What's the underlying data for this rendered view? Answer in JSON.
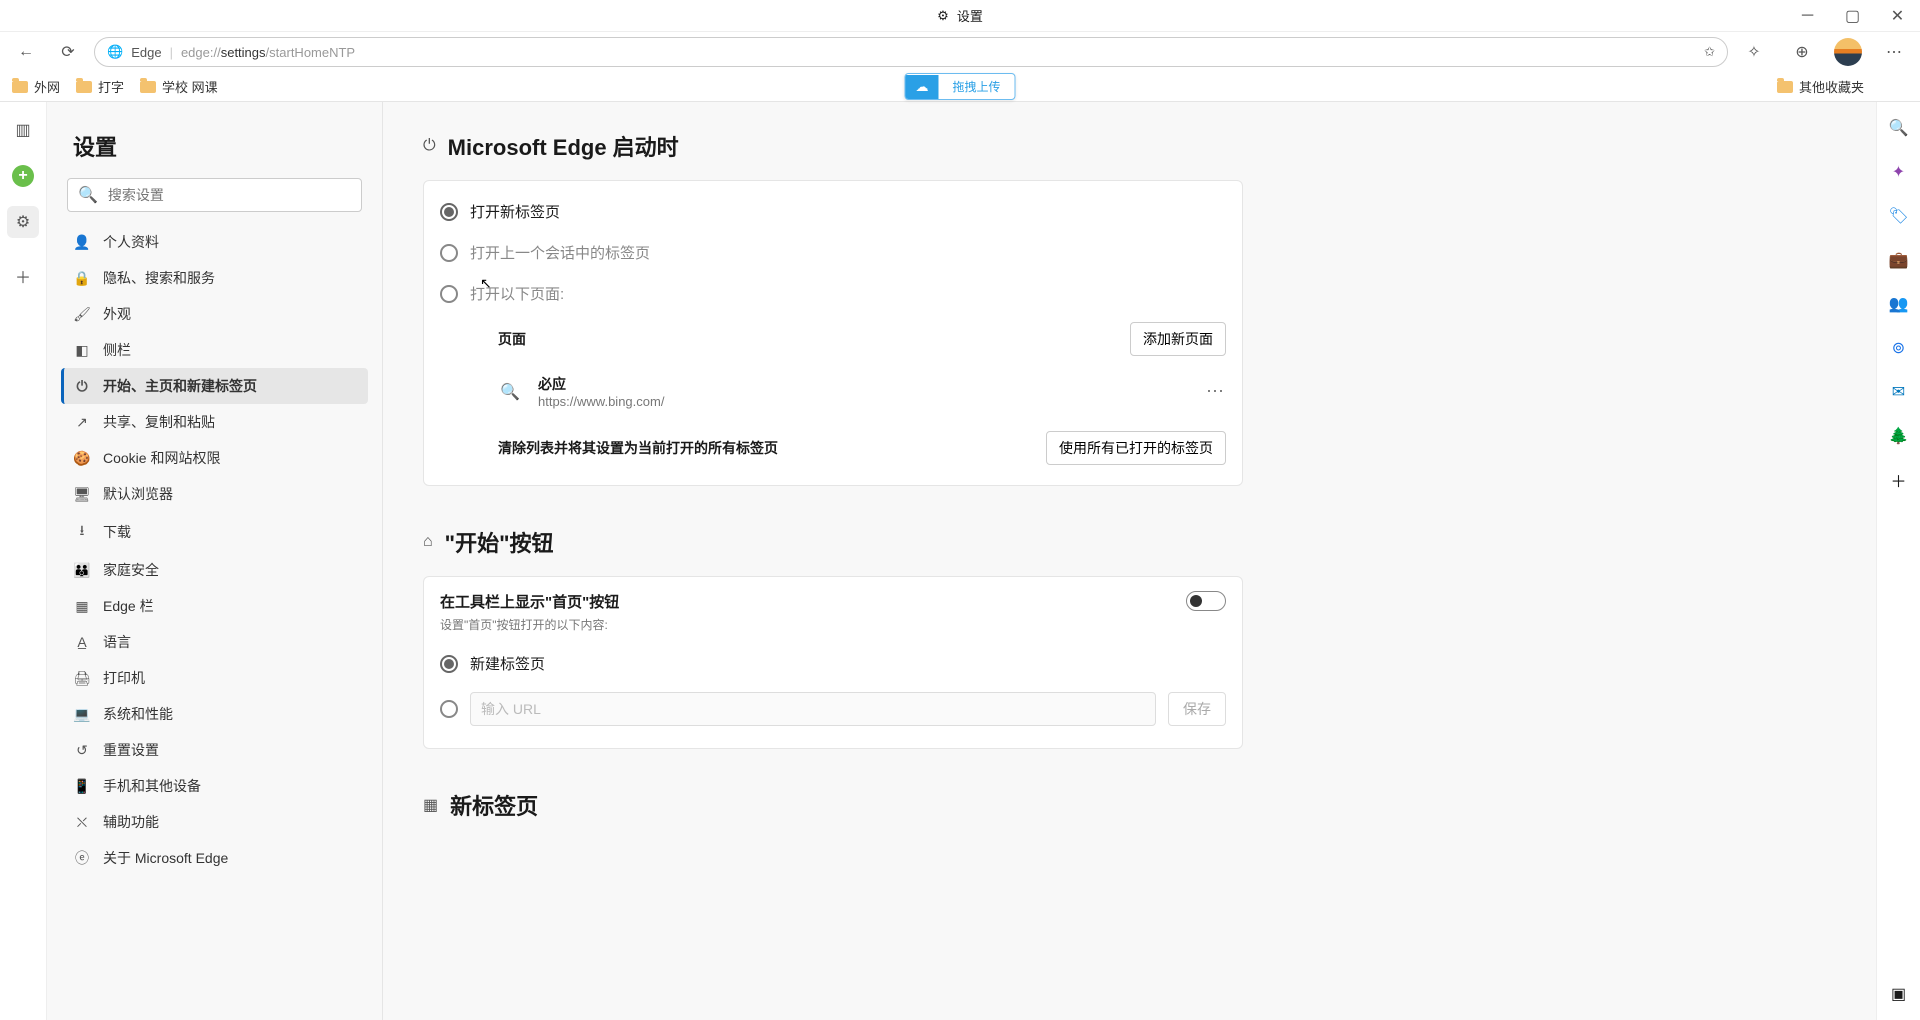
{
  "titlebar": {
    "label": "设置"
  },
  "toolbar": {
    "edge_label": "Edge",
    "url_prefix": "edge://",
    "url_bold": "settings",
    "url_rest": "/startHomeNTP"
  },
  "bookmarks": {
    "items": [
      "外网",
      "打字",
      "学校 网课"
    ],
    "right": "其他收藏夹",
    "upload": "拖拽上传"
  },
  "sidebar": {
    "title": "设置",
    "search_placeholder": "搜索设置",
    "items": [
      "个人资料",
      "隐私、搜索和服务",
      "外观",
      "侧栏",
      "开始、主页和新建标签页",
      "共享、复制和粘贴",
      "Cookie 和网站权限",
      "默认浏览器",
      "下载",
      "家庭安全",
      "Edge 栏",
      "语言",
      "打印机",
      "系统和性能",
      "重置设置",
      "手机和其他设备",
      "辅助功能",
      "关于 Microsoft Edge"
    ],
    "active_index": 4
  },
  "section1": {
    "title": "Microsoft Edge 启动时",
    "options": [
      "打开新标签页",
      "打开上一个会话中的标签页",
      "打开以下页面:"
    ],
    "selected": 0,
    "pages_label": "页面",
    "add_page": "添加新页面",
    "bing": {
      "name": "必应",
      "url": "https://www.bing.com/"
    },
    "clear_label": "清除列表并将其设置为当前打开的所有标签页",
    "use_open": "使用所有已打开的标签页"
  },
  "section2": {
    "title": "\"开始\"按钮",
    "toggle_label": "在工具栏上显示\"首页\"按钮",
    "toggle_desc": "设置\"首页\"按钮打开的以下内容:",
    "opt1": "新建标签页",
    "url_placeholder": "输入 URL",
    "save": "保存"
  },
  "section3": {
    "title": "新标签页"
  }
}
